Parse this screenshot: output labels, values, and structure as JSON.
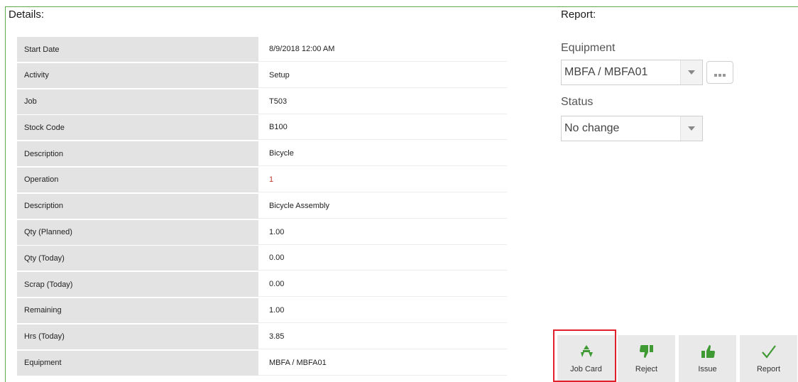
{
  "details": {
    "title": "Details:",
    "rows": [
      {
        "label": "Start Date",
        "value": "8/9/2018 12:00 AM"
      },
      {
        "label": "Activity",
        "value": "Setup"
      },
      {
        "label": "Job",
        "value": "T503"
      },
      {
        "label": "Stock Code",
        "value": "B100"
      },
      {
        "label": "Description",
        "value": "Bicycle"
      },
      {
        "label": "Operation",
        "value": "1"
      },
      {
        "label": "Description",
        "value": "Bicycle Assembly"
      },
      {
        "label": "Qty (Planned)",
        "value": "1.00"
      },
      {
        "label": "Qty (Today)",
        "value": "0.00"
      },
      {
        "label": "Scrap (Today)",
        "value": "0.00"
      },
      {
        "label": "Remaining",
        "value": "1.00"
      },
      {
        "label": "Hrs (Today)",
        "value": "3.85"
      },
      {
        "label": "Equipment",
        "value": "MBFA / MBFA01"
      }
    ]
  },
  "report": {
    "title": "Report:",
    "equipment": {
      "label": "Equipment",
      "value": "MBFA / MBFA01"
    },
    "status": {
      "label": "Status",
      "value": "No change"
    }
  },
  "actions": {
    "job_card": "Job Card",
    "reject": "Reject",
    "issue": "Issue",
    "report": "Report"
  },
  "colors": {
    "accent_green": "#3f9a34",
    "frame_green": "#5bab4b",
    "highlight_red": "#e0202a",
    "label_bg": "#e3e3e3",
    "operation_value": "#c0392b"
  },
  "icons": {
    "job_card": "job-card-icon",
    "reject": "thumbs-down-icon",
    "issue": "thumbs-up-icon",
    "report": "checkmark-icon"
  }
}
